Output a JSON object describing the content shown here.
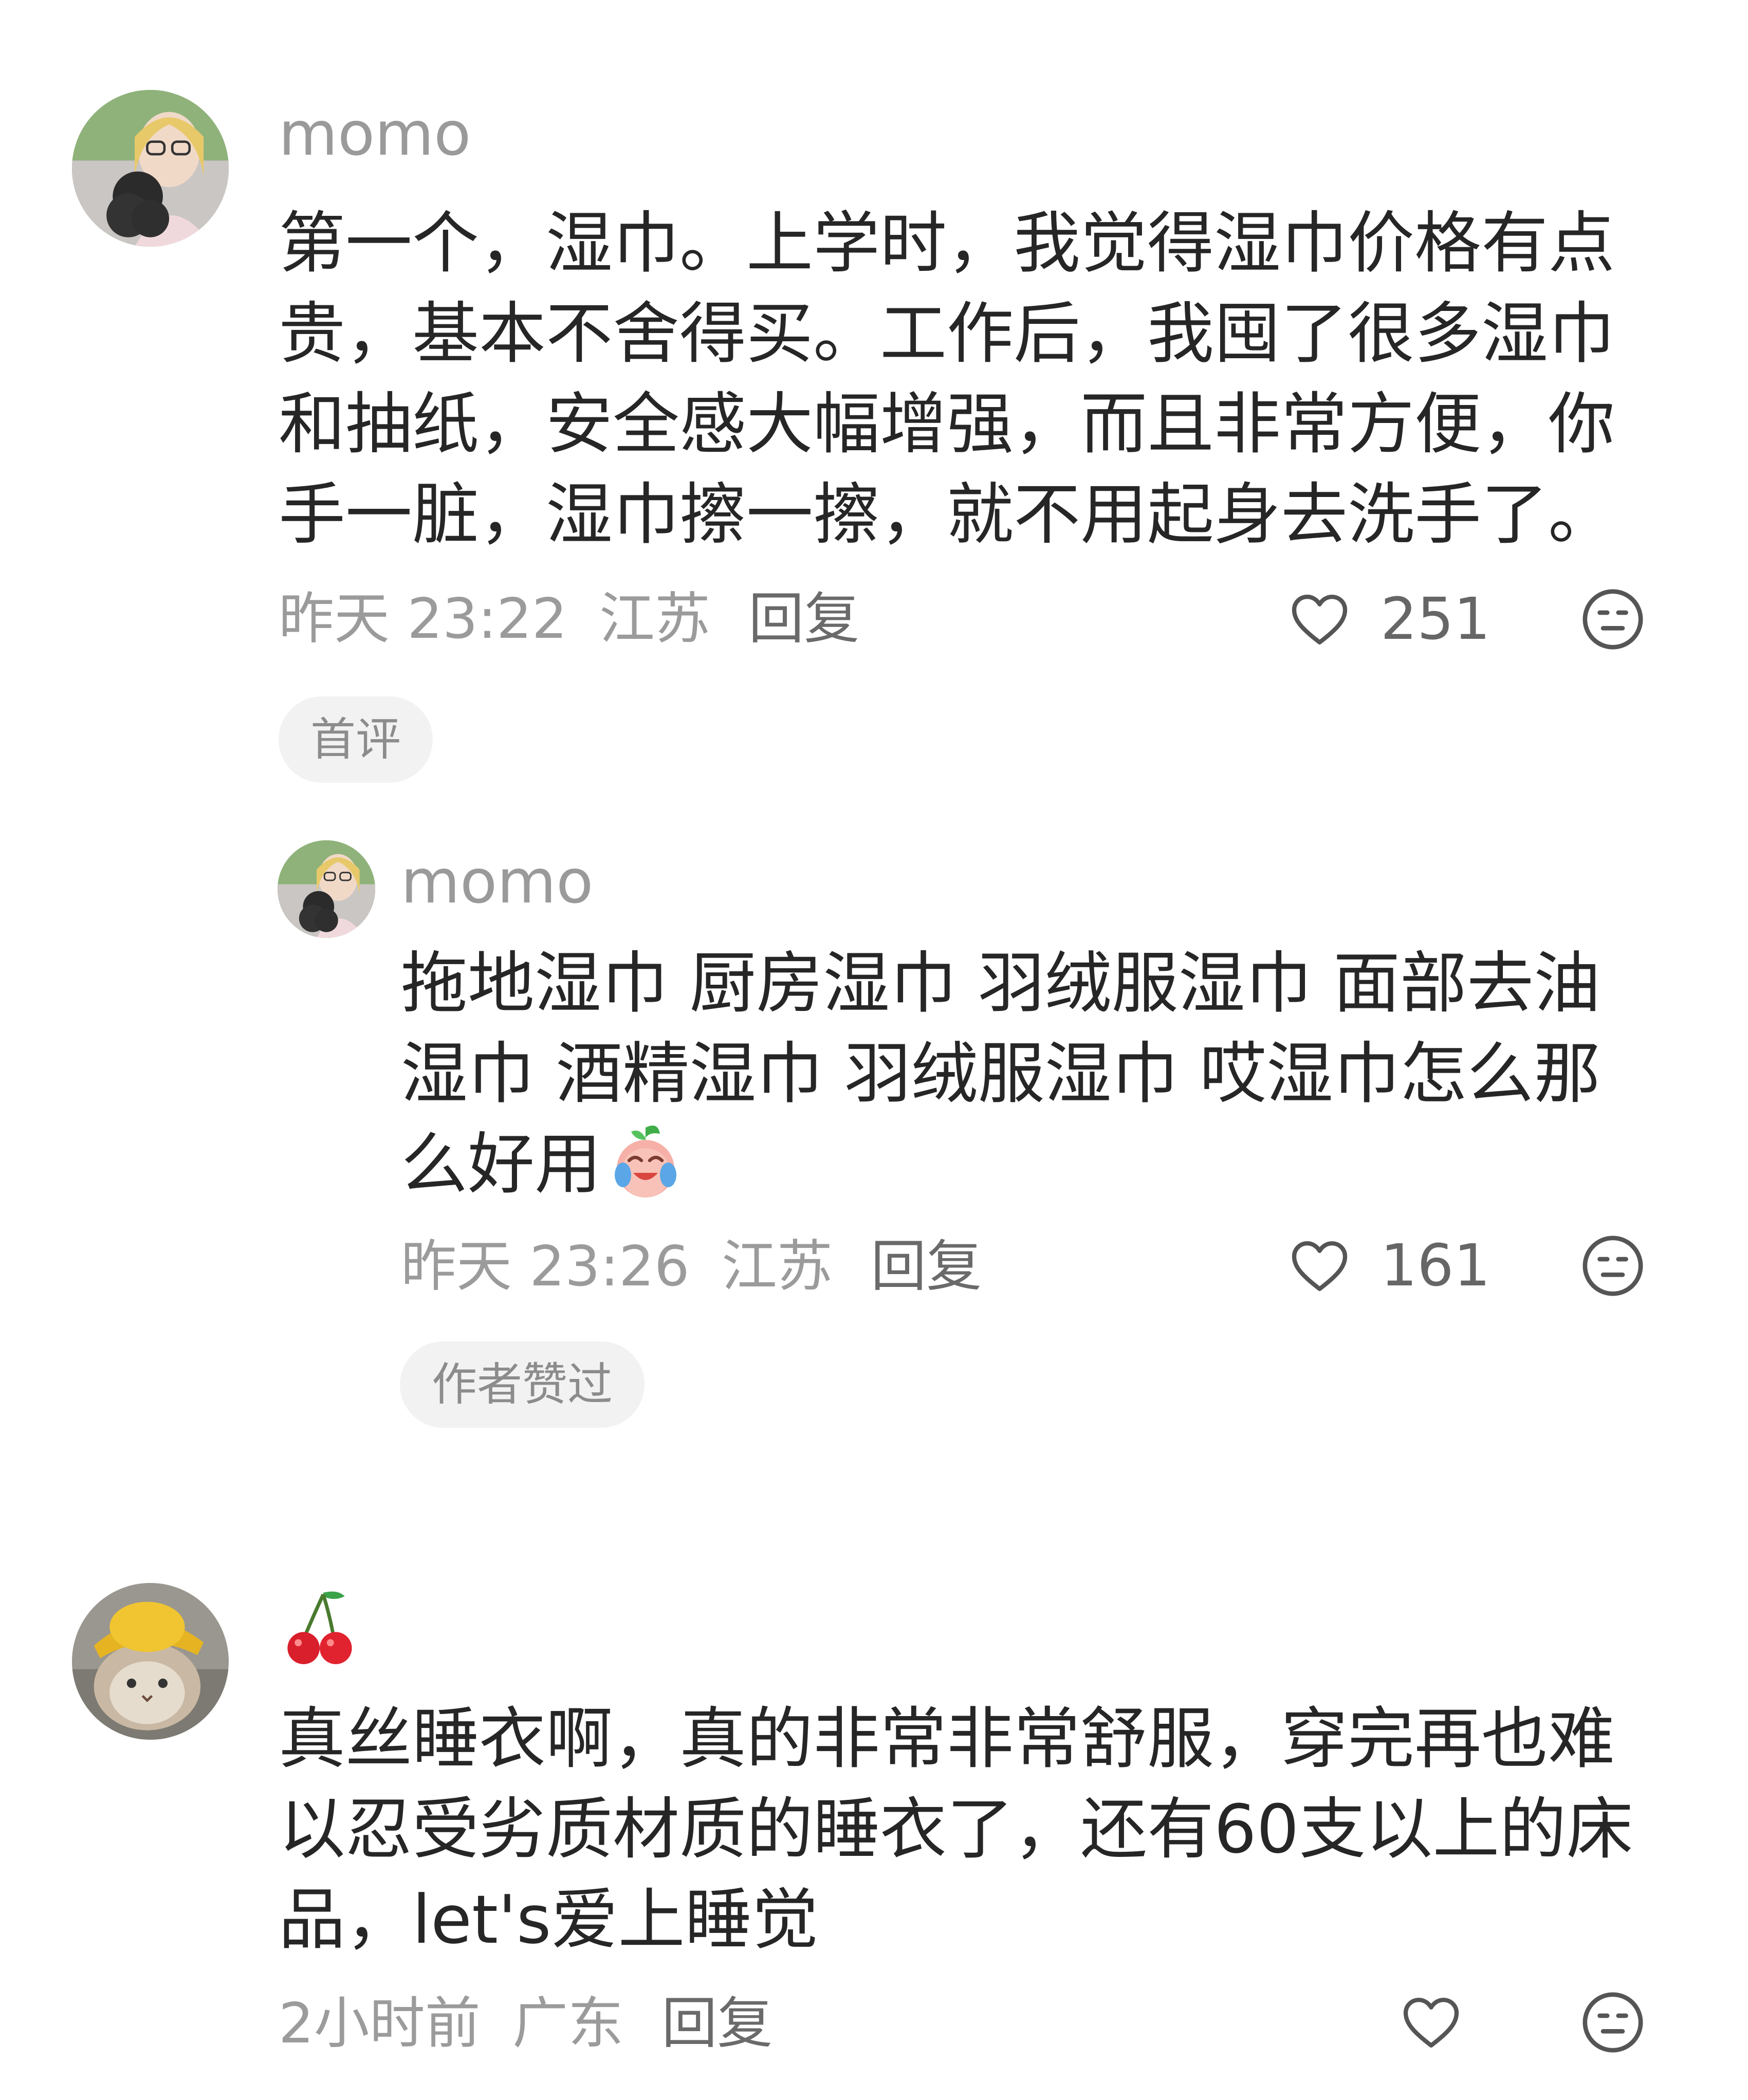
{
  "comments": [
    {
      "avatar_icon": "avatar-girl-with-dog",
      "username": "momo",
      "text": "第一个，湿巾。上学时，我觉得湿巾价格有点贵，基本不舍得买。工作后，我囤了很多湿巾和抽纸，安全感大幅增强，而且非常方便，你手一脏，湿巾擦一擦，就不用起身去洗手了。",
      "time": "昨天 23:22",
      "location": "江苏",
      "reply_label": "回复",
      "likes": "251",
      "tag": "首评",
      "replies": [
        {
          "avatar_icon": "avatar-girl-with-dog",
          "username": "momo",
          "text": "拖地湿巾 厨房湿巾 羽绒服湿巾 面部去油湿巾 酒精湿巾 羽绒服湿巾 哎湿巾怎么那么好用",
          "emoji": "crying-laugh-peach-emoji",
          "time": "昨天 23:26",
          "location": "江苏",
          "reply_label": "回复",
          "likes": "161",
          "tag": "作者赞过"
        }
      ]
    },
    {
      "avatar_icon": "avatar-cat-with-yellow-hat",
      "username_icon": "cherry-emoji",
      "text": "真丝睡衣啊，真的非常非常舒服，穿完再也难以忍受劣质材质的睡衣了，还有60支以上的床品，let's爱上睡觉",
      "time": "2小时前",
      "location": "广东",
      "reply_label": "回复",
      "likes": ""
    }
  ],
  "colors": {
    "text": "#262626",
    "meta": "#9b9b9b",
    "chip_bg": "#f2f2f2"
  }
}
